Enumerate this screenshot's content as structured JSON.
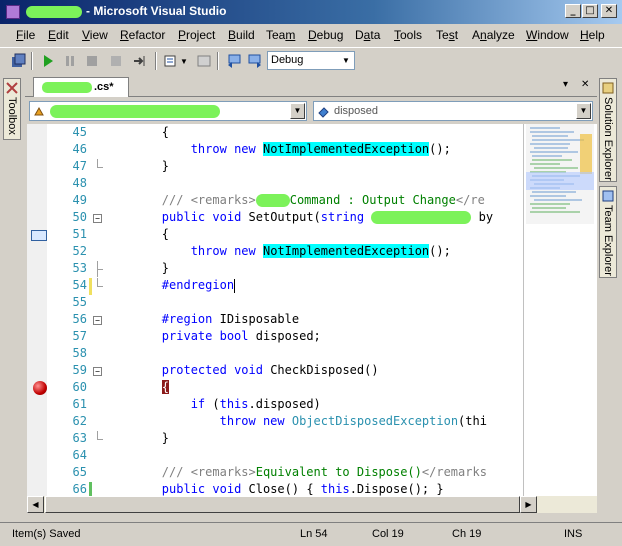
{
  "window": {
    "title": "- Microsoft Visual Studio",
    "minimize": "_",
    "maximize": "□",
    "close": "✕"
  },
  "menu": [
    "File",
    "Edit",
    "View",
    "Refactor",
    "Project",
    "Build",
    "Team",
    "Debug",
    "Data",
    "Tools",
    "Test",
    "Analyze",
    "Window",
    "Help"
  ],
  "menu_accel": [
    "F",
    "E",
    "V",
    "R",
    "P",
    "B",
    "m",
    "D",
    "a",
    "T",
    "s",
    "n",
    "W",
    "H"
  ],
  "toolbar": {
    "configuration": "Debug",
    "icons": [
      "save-all-icon",
      "start-debugging-icon",
      "break-all-icon",
      "stop-debugging-icon",
      "restart-icon",
      "show-next-statement-icon",
      "find-in-files-icon",
      "toggle-window-icon",
      "navigate-backward-icon",
      "navigate-forward-icon"
    ]
  },
  "side_panels": {
    "toolbox": "Toolbox",
    "solution_explorer": "Solution Explorer",
    "team_explorer": "Team Explorer"
  },
  "document": {
    "tab_label": ".cs*",
    "tab_close": "✕",
    "tab_dropdown": "▾",
    "member_combo": "disposed"
  },
  "code": [
    {
      "n": "45",
      "parts": [
        [
          "",
          "        {"
        ]
      ]
    },
    {
      "n": "46",
      "parts": [
        [
          "",
          "            "
        ],
        [
          "kw",
          "throw"
        ],
        [
          "",
          " "
        ],
        [
          "kw",
          "new"
        ],
        [
          "",
          " "
        ],
        [
          "hl",
          "NotImplementedException"
        ],
        [
          "",
          "();"
        ]
      ]
    },
    {
      "n": "47",
      "parts": [
        [
          "",
          "        }"
        ]
      ]
    },
    {
      "n": "48",
      "parts": [
        [
          "",
          ""
        ]
      ]
    },
    {
      "n": "49",
      "parts": [
        [
          "",
          "        "
        ],
        [
          "xd",
          "/// <remarks>"
        ],
        [
          "blur",
          ""
        ],
        [
          "cm",
          "Command : Output Change"
        ],
        [
          "xd",
          "</re"
        ]
      ]
    },
    {
      "n": "50",
      "parts": [
        [
          "",
          "        "
        ],
        [
          "kw",
          "public"
        ],
        [
          "",
          " "
        ],
        [
          "kw",
          "void"
        ],
        [
          "",
          " SetOutput("
        ],
        [
          "kw",
          "string"
        ],
        [
          "",
          " "
        ],
        [
          "blur",
          ""
        ],
        [
          "",
          " by"
        ]
      ]
    },
    {
      "n": "51",
      "parts": [
        [
          "",
          "        {"
        ]
      ]
    },
    {
      "n": "52",
      "parts": [
        [
          "",
          "            "
        ],
        [
          "kw",
          "throw"
        ],
        [
          "",
          " "
        ],
        [
          "kw",
          "new"
        ],
        [
          "",
          " "
        ],
        [
          "hl",
          "NotImplementedException"
        ],
        [
          "",
          "();"
        ]
      ]
    },
    {
      "n": "53",
      "parts": [
        [
          "",
          "        }"
        ]
      ]
    },
    {
      "n": "54",
      "parts": [
        [
          "",
          "        "
        ],
        [
          "kw",
          "#endregion"
        ]
      ]
    },
    {
      "n": "55",
      "parts": [
        [
          "",
          ""
        ]
      ]
    },
    {
      "n": "56",
      "parts": [
        [
          "",
          "        "
        ],
        [
          "kw",
          "#region"
        ],
        [
          "",
          " IDisposable"
        ]
      ]
    },
    {
      "n": "57",
      "parts": [
        [
          "",
          "        "
        ],
        [
          "kw",
          "private"
        ],
        [
          "",
          " "
        ],
        [
          "kw",
          "bool"
        ],
        [
          "",
          " disposed;"
        ]
      ]
    },
    {
      "n": "58",
      "parts": [
        [
          "",
          ""
        ]
      ]
    },
    {
      "n": "59",
      "parts": [
        [
          "",
          "        "
        ],
        [
          "kw",
          "protected"
        ],
        [
          "",
          " "
        ],
        [
          "kw",
          "void"
        ],
        [
          "",
          " CheckDisposed()"
        ]
      ]
    },
    {
      "n": "60",
      "parts": [
        [
          "",
          "        "
        ],
        [
          "bp",
          "{"
        ]
      ]
    },
    {
      "n": "61",
      "parts": [
        [
          "",
          "            "
        ],
        [
          "kw",
          "if"
        ],
        [
          "",
          " ("
        ],
        [
          "kw",
          "this"
        ],
        [
          "",
          ".disposed)"
        ]
      ]
    },
    {
      "n": "62",
      "parts": [
        [
          "",
          "                "
        ],
        [
          "kw",
          "throw"
        ],
        [
          "",
          " "
        ],
        [
          "kw",
          "new"
        ],
        [
          "",
          " "
        ],
        [
          "ty",
          "ObjectDisposedException"
        ],
        [
          "",
          "(thi"
        ]
      ]
    },
    {
      "n": "63",
      "parts": [
        [
          "",
          "        }"
        ]
      ]
    },
    {
      "n": "64",
      "parts": [
        [
          "",
          ""
        ]
      ]
    },
    {
      "n": "65",
      "parts": [
        [
          "",
          "        "
        ],
        [
          "xd",
          "/// <remarks>"
        ],
        [
          "cm",
          "Equivalent to Dispose()"
        ],
        [
          "xd",
          "</remarks"
        ]
      ]
    },
    {
      "n": "66",
      "parts": [
        [
          "",
          "        "
        ],
        [
          "kw",
          "public"
        ],
        [
          "",
          " "
        ],
        [
          "kw",
          "void"
        ],
        [
          "",
          " Close() { "
        ],
        [
          "kw",
          "this"
        ],
        [
          "",
          ".Dispose(); }"
        ]
      ]
    }
  ],
  "status": {
    "message": "Item(s) Saved",
    "line": "Ln 54",
    "col": "Col 19",
    "ch": "Ch 19",
    "mode": "INS"
  },
  "colors": {
    "keyword": "#0000ff",
    "comment": "#008000",
    "line_number": "#2b91af",
    "highlight": "#00ffff",
    "breakpoint": "#c00000"
  }
}
